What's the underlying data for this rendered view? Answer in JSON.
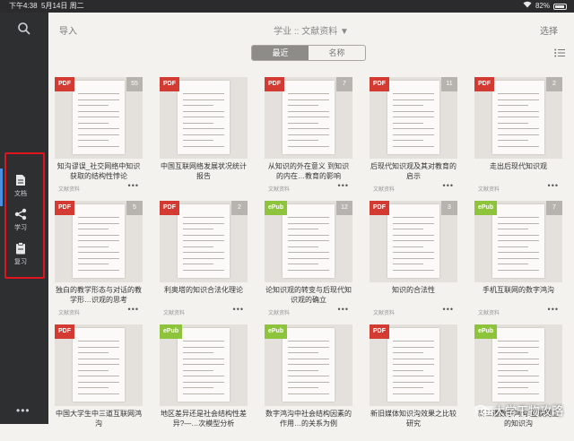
{
  "status": {
    "time": "下午4:38",
    "date": "5月14日 周二",
    "battery": "82%"
  },
  "sidebar": {
    "items": [
      {
        "label": "文档",
        "icon": "document-icon"
      },
      {
        "label": "学习",
        "icon": "share-icon"
      },
      {
        "label": "复习",
        "icon": "clipboard-icon"
      }
    ],
    "more": "•••"
  },
  "toolbar": {
    "import": "导入",
    "breadcrumb": "学业 :: 文献资料 ▼",
    "select": "选择"
  },
  "sort": {
    "recent": "最近",
    "name": "名称"
  },
  "docs": [
    {
      "type": "PDF",
      "count": "55",
      "title": "知沟谬误_社交网络中知识获取的结构性悖论",
      "meta": "文献资料"
    },
    {
      "type": "PDF",
      "count": "",
      "title": "中国互联网络发展状况统计报告",
      "meta": ""
    },
    {
      "type": "PDF",
      "count": "7",
      "title": "从知识的外在意义 到知识的内在…教育的影响",
      "meta": "文献资料"
    },
    {
      "type": "PDF",
      "count": "11",
      "title": "后现代知识观及其对教育的启示",
      "meta": "文献资料"
    },
    {
      "type": "PDF",
      "count": "2",
      "title": "走出后现代知识观",
      "meta": "文献资料"
    },
    {
      "type": "PDF",
      "count": "5",
      "title": "独白的教学形态与对话的教学形…识观的思考",
      "meta": "文献资料"
    },
    {
      "type": "PDF",
      "count": "2",
      "title": "利奥塔的知识合法化理论",
      "meta": "文献资料"
    },
    {
      "type": "ePub",
      "count": "12",
      "title": "论知识观的转变与后现代知识观的确立",
      "meta": "文献资料"
    },
    {
      "type": "PDF",
      "count": "3",
      "title": "知识的合法性",
      "meta": "文献资料"
    },
    {
      "type": "ePub",
      "count": "7",
      "title": "手机互联网的数字鸿沟",
      "meta": "文献资料"
    },
    {
      "type": "PDF",
      "count": "",
      "title": "中国大学生中三道互联网鸿沟",
      "meta": ""
    },
    {
      "type": "ePub",
      "count": "",
      "title": "地区差异还是社会结构性差异?—…次模型分析",
      "meta": ""
    },
    {
      "type": "ePub",
      "count": "",
      "title": "数字鸿沟中社会结构因素的作用…的关系为例",
      "meta": ""
    },
    {
      "type": "PDF",
      "count": "",
      "title": "新旧媒体知识沟效果之比较研究",
      "meta": ""
    },
    {
      "type": "ePub",
      "count": "",
      "title": "新三道数字鸿沟:互联网上的知识沟",
      "meta": ""
    }
  ],
  "watermark": "大学干物攻略",
  "colors": {
    "pdf": "#d33a32",
    "epub": "#8ec43c",
    "highlight": "#e0141e",
    "sidebar": "#2e2f31"
  }
}
